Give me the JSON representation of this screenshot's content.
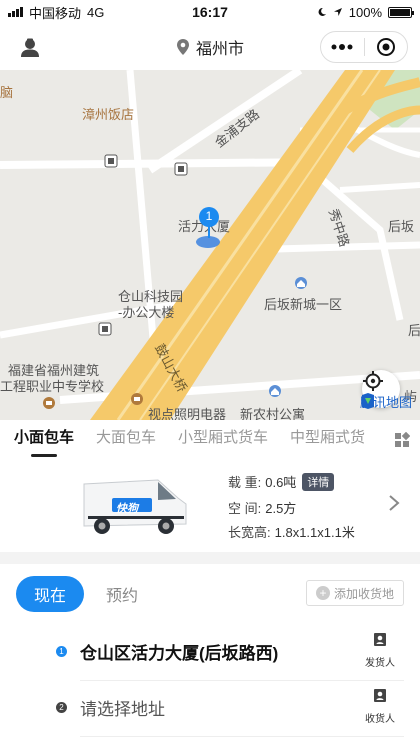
{
  "status_bar": {
    "carrier": "中国移动",
    "network": "4G",
    "time": "16:17",
    "battery": "100%"
  },
  "nav": {
    "city": "福州市"
  },
  "map": {
    "labels": {
      "nao": "脑",
      "zhangzhou_hotel": "漳州饭店",
      "jinpu_road": "金浦支路",
      "houban": "后坂",
      "huoli": "活力大厦",
      "pin_number": "1",
      "jianzhong": "秀中路",
      "cangshan_tech_1": "仓山科技园",
      "cangshan_tech_2": "-办公大楼",
      "houban_new": "后坂新城一区",
      "hou_right": "后",
      "gushan": "鼓山大桥",
      "fujian_jz_1": "福建省福州建筑",
      "fujian_jz_2": "工程职业中专学校",
      "shidian": "视点照明电器",
      "xincun": "新农村公寓",
      "yu": "屿",
      "watermark": "腾讯地图"
    }
  },
  "tabs": [
    {
      "label": "小面包车",
      "active": true
    },
    {
      "label": "大面包车",
      "active": false
    },
    {
      "label": "小型厢式货车",
      "active": false
    },
    {
      "label": "中型厢式货",
      "active": false
    }
  ],
  "vehicle": {
    "load_key": "载  重:",
    "load_val": "0.6吨",
    "detail_badge": "详情",
    "volume_key": "空  间:",
    "volume_val": "2.5方",
    "size_key": "长宽高:",
    "size_val": "1.8x1.1x1.1米",
    "van_logo": "快狗"
  },
  "order": {
    "now_label": "现在",
    "later_label": "预约",
    "add_receiver_label": "添加收货地",
    "addresses": [
      {
        "index": "1",
        "text": "仓山区活力大厦(后坂路西)",
        "contact_label": "发货人",
        "color": "#1b8af0",
        "text_color": "#111"
      },
      {
        "index": "2",
        "text": "请选择地址",
        "contact_label": "收货人",
        "color": "#444444",
        "text_color": "#555"
      }
    ]
  },
  "colors": {
    "accent": "#1b8af0",
    "road_yellow": "#f5c96a",
    "map_bg": "#ebeae6"
  }
}
